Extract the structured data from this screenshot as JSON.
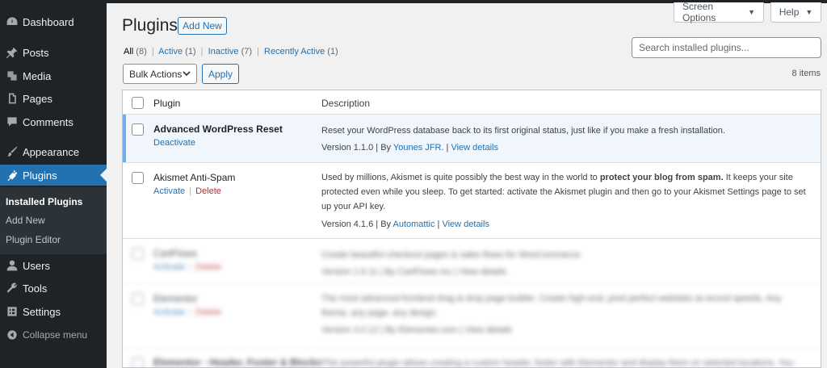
{
  "sidebar": {
    "items": [
      {
        "label": "Dashboard",
        "icon": "dashboard-icon"
      },
      {
        "label": "Posts",
        "icon": "pin-icon"
      },
      {
        "label": "Media",
        "icon": "media-icon"
      },
      {
        "label": "Pages",
        "icon": "pages-icon"
      },
      {
        "label": "Comments",
        "icon": "comments-icon"
      },
      {
        "label": "Appearance",
        "icon": "brush-icon"
      },
      {
        "label": "Plugins",
        "icon": "plugin-icon"
      },
      {
        "label": "Users",
        "icon": "users-icon"
      },
      {
        "label": "Tools",
        "icon": "wrench-icon"
      },
      {
        "label": "Settings",
        "icon": "settings-icon"
      }
    ],
    "submenu": [
      "Installed Plugins",
      "Add New",
      "Plugin Editor"
    ],
    "collapse_label": "Collapse menu"
  },
  "header": {
    "screen_options": "Screen Options",
    "help": "Help",
    "title": "Plugins",
    "add_new": "Add New"
  },
  "filters": {
    "all": "All",
    "all_count": "(8)",
    "active": "Active",
    "active_count": "(1)",
    "inactive": "Inactive",
    "inactive_count": "(7)",
    "recent": "Recently Active",
    "recent_count": "(1)"
  },
  "search": {
    "placeholder": "Search installed plugins..."
  },
  "bulk": {
    "label": "Bulk Actions",
    "apply": "Apply",
    "items": "8 items"
  },
  "table": {
    "col_plugin": "Plugin",
    "col_description": "Description",
    "rows": [
      {
        "name": "Advanced WordPress Reset",
        "action1": "Deactivate",
        "description": "Reset your WordPress database back to its first original status, just like if you make a fresh installation.",
        "version": "Version 1.1.0",
        "by": "By",
        "author": "Younes JFR.",
        "details": "View details"
      },
      {
        "name": "Akismet Anti-Spam",
        "action1": "Activate",
        "action2": "Delete",
        "desc_a": "Used by millions, Akismet is quite possibly the best way in the world to",
        "desc_strong": "protect your blog from spam.",
        "desc_b": "It keeps your site protected even while you sleep. To get started: activate the Akismet plugin and then go to your Akismet Settings page to set up your API key.",
        "version": "Version 4.1.6",
        "by": "By",
        "author": "Automattic",
        "details": "View details"
      },
      {
        "name": "CartFlows",
        "action1": "Activate",
        "action2": "Delete",
        "description": "Create beautiful checkout pages & sales flows for WooCommerce.",
        "meta": "Version 1.6.11 | By CartFlows Inc | View details"
      },
      {
        "name": "Elementor",
        "action1": "Activate",
        "action2": "Delete",
        "description": "The most advanced frontend drag & drop page builder. Create high-end, pixel perfect websites at record speeds. Any theme, any page, any design.",
        "meta": "Version 3.0.12 | By Elementor.com | View details"
      },
      {
        "name": "Elementor - Header, Footer & Blocks",
        "description": "This powerful plugin allows creating a custom header, footer with Elementor and display them on selected locations. You can"
      }
    ]
  },
  "colors": {
    "sidebar_bg": "#1d2327",
    "accent": "#2271b1",
    "active_row": "#f0f6fc"
  }
}
